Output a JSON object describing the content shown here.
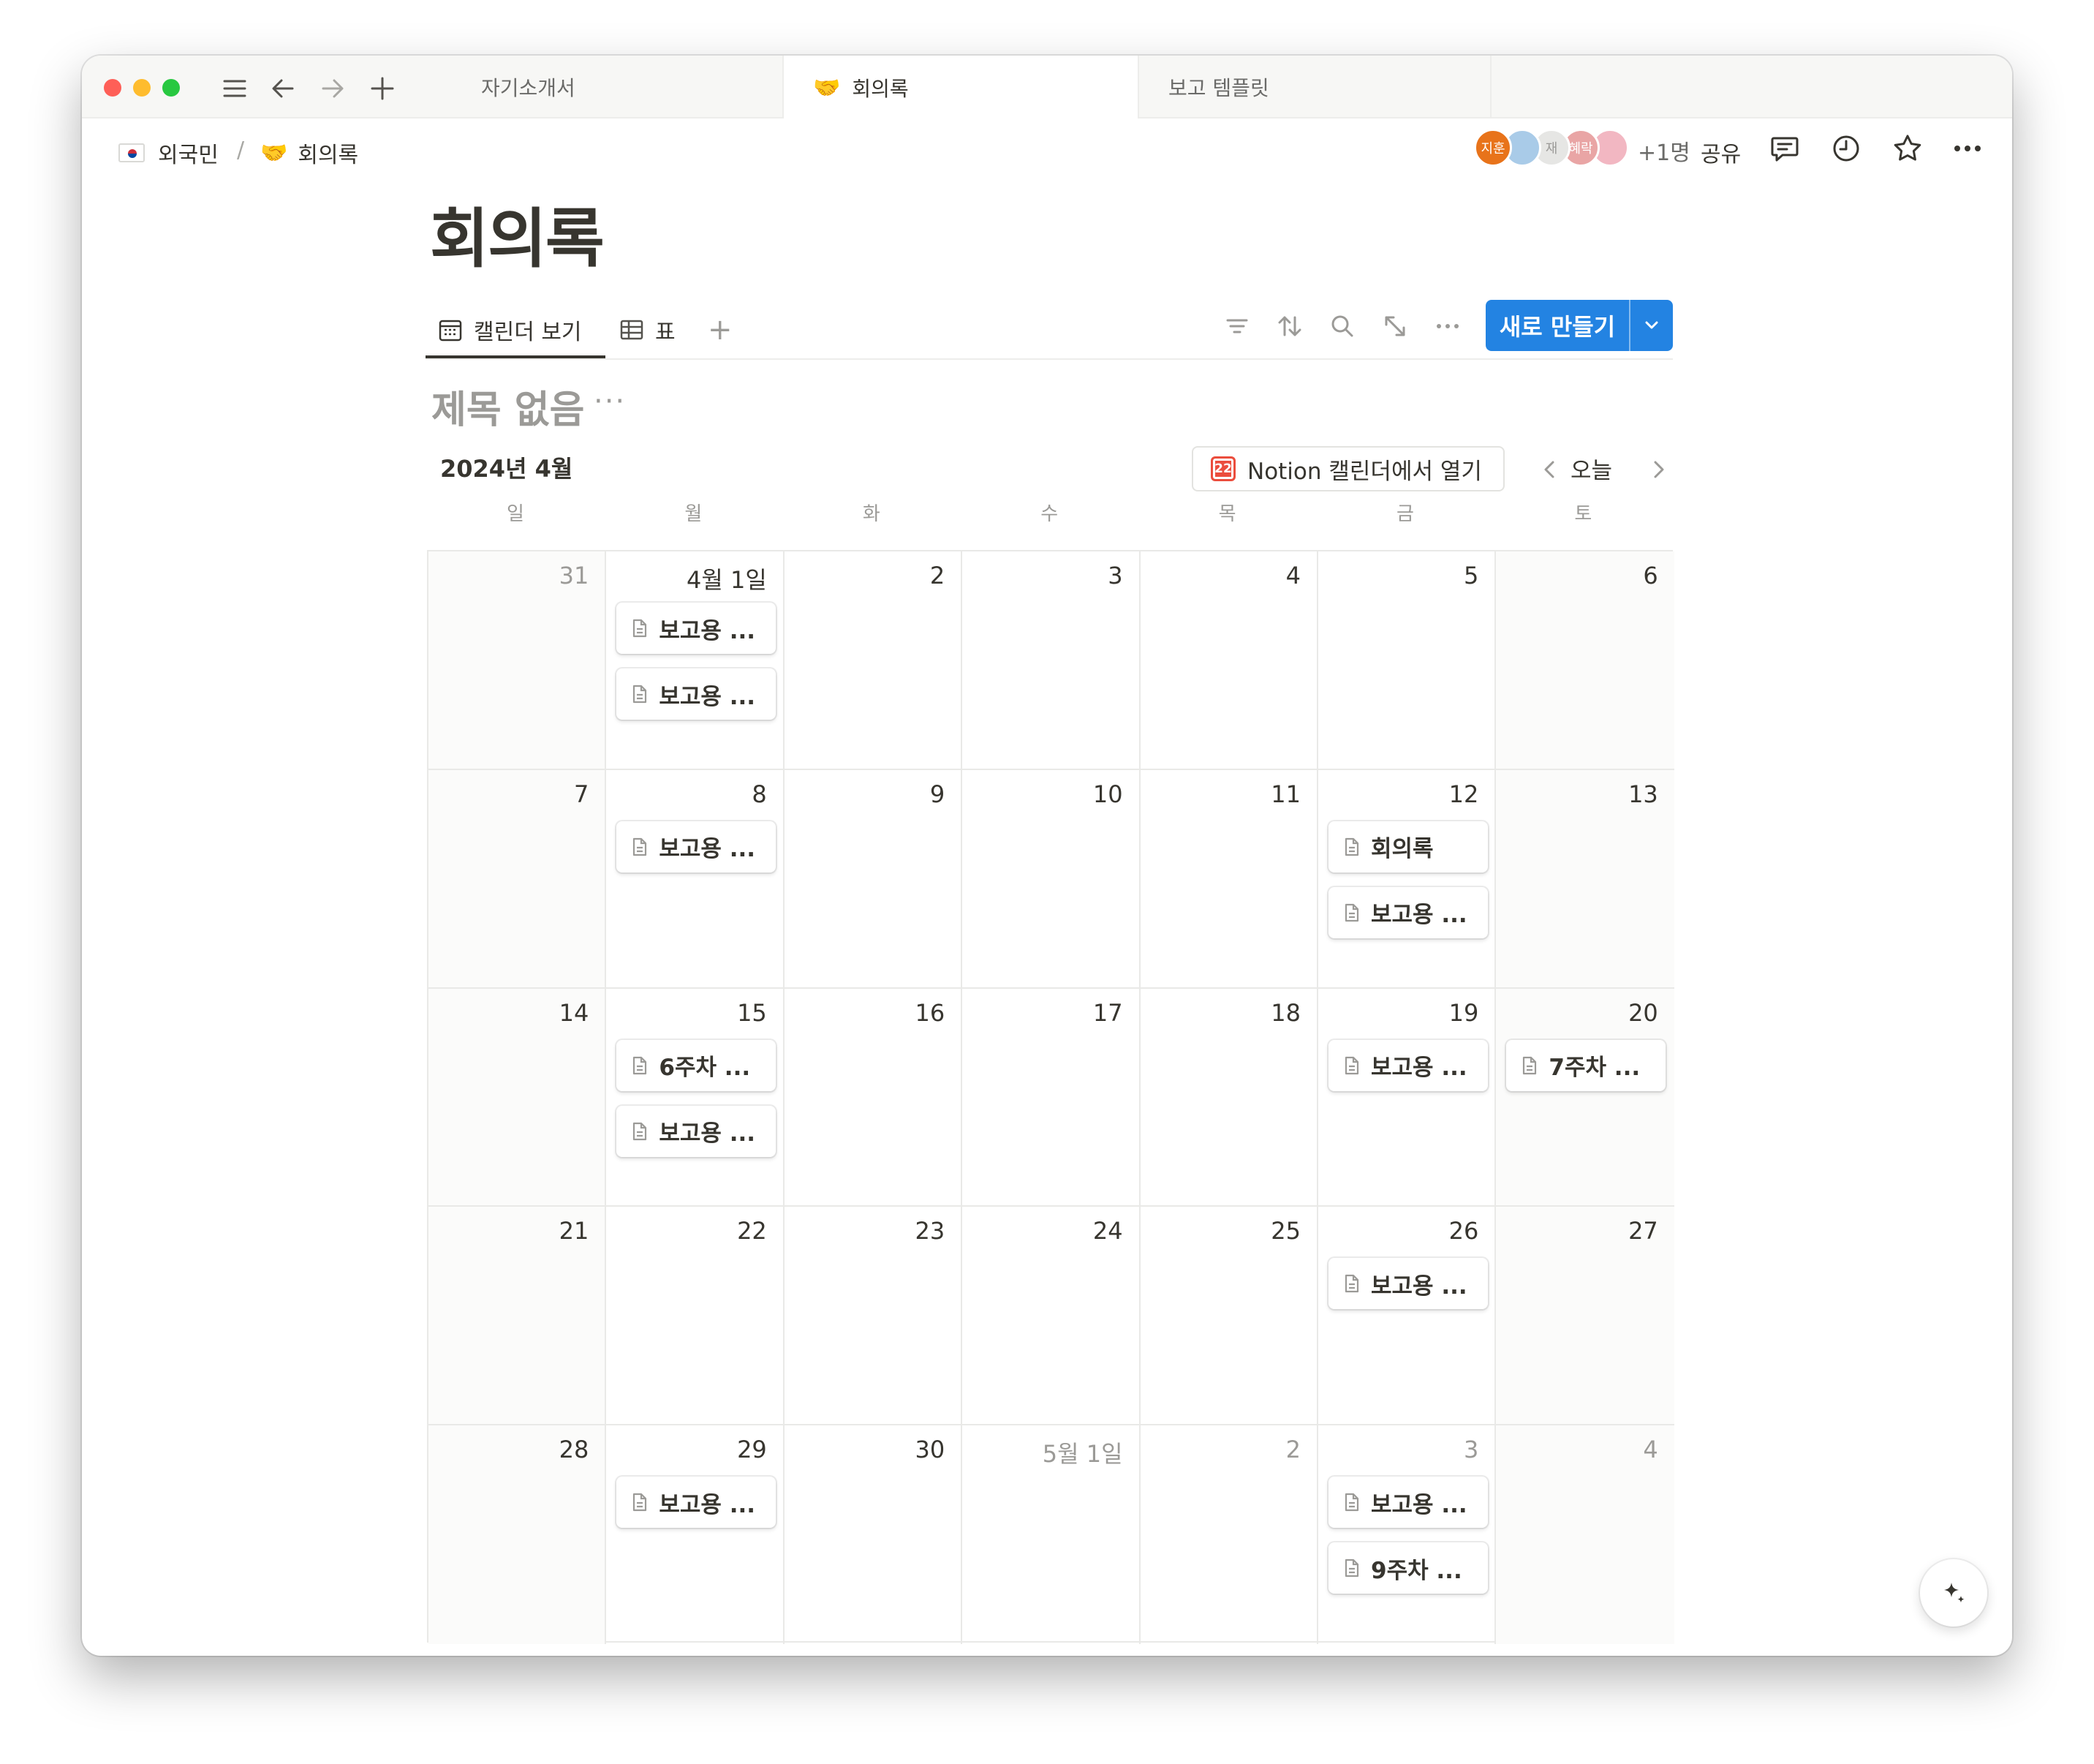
{
  "window": {
    "tabs": [
      {
        "label": "자기소개서",
        "emoji": ""
      },
      {
        "label": "회의록",
        "emoji": "🤝"
      },
      {
        "label": "보고 템플릿",
        "emoji": ""
      }
    ],
    "active_tab": 1
  },
  "breadcrumb": [
    {
      "label": "외국민",
      "icon": "korea-flag-icon"
    },
    {
      "label": "회의록",
      "icon": "handshake-icon",
      "emoji": "🤝"
    }
  ],
  "breadcrumb_separator": "/",
  "collaborators": {
    "avatars": [
      {
        "label": "지훈",
        "color": "#e8731a"
      },
      {
        "label": "",
        "color": "#a9cbe8"
      },
      {
        "label": "재",
        "color": "#e6e6e4"
      },
      {
        "label": "혜락",
        "color": "#e9a5a5"
      },
      {
        "label": "",
        "color": "#f2b7c2"
      }
    ],
    "more_count": "+1명"
  },
  "topbar": {
    "share_label": "공유"
  },
  "page": {
    "title": "회의록"
  },
  "views": {
    "calendar_label": "캘린더 보기",
    "table_label": "표",
    "add_label": "+"
  },
  "toolbar": {
    "new_label": "새로 만들기"
  },
  "database": {
    "title": "제목 없음",
    "more": "···"
  },
  "calendar": {
    "month_label": "2024년 4월",
    "open_in_calendar": "Notion 캘린더에서 열기",
    "calendar_icon_day": "22",
    "today_label": "오늘",
    "weekdays": [
      "일",
      "월",
      "화",
      "수",
      "목",
      "금",
      "토"
    ],
    "weeks": [
      [
        {
          "label": "31",
          "muted": true,
          "events": []
        },
        {
          "label": "4월 1일",
          "muted": false,
          "events": [
            "보고용 ...",
            " 보고용 ..."
          ]
        },
        {
          "label": "2",
          "muted": false,
          "events": []
        },
        {
          "label": "3",
          "muted": false,
          "events": []
        },
        {
          "label": "4",
          "muted": false,
          "events": []
        },
        {
          "label": "5",
          "muted": false,
          "events": []
        },
        {
          "label": "6",
          "muted": false,
          "events": []
        }
      ],
      [
        {
          "label": "7",
          "muted": false,
          "events": []
        },
        {
          "label": "8",
          "muted": false,
          "events": [
            "보고용 ..."
          ]
        },
        {
          "label": "9",
          "muted": false,
          "events": []
        },
        {
          "label": "10",
          "muted": false,
          "events": []
        },
        {
          "label": "11",
          "muted": false,
          "events": []
        },
        {
          "label": "12",
          "muted": false,
          "events": [
            "회의록",
            "보고용 ..."
          ]
        },
        {
          "label": "13",
          "muted": false,
          "events": []
        }
      ],
      [
        {
          "label": "14",
          "muted": false,
          "events": []
        },
        {
          "label": "15",
          "muted": false,
          "events": [
            "6주차 ...",
            "보고용 ..."
          ]
        },
        {
          "label": "16",
          "muted": false,
          "events": []
        },
        {
          "label": "17",
          "muted": false,
          "events": []
        },
        {
          "label": "18",
          "muted": false,
          "events": []
        },
        {
          "label": "19",
          "muted": false,
          "events": [
            "보고용 ..."
          ]
        },
        {
          "label": "20",
          "muted": false,
          "events": [
            "7주차 ..."
          ]
        }
      ],
      [
        {
          "label": "21",
          "muted": false,
          "events": []
        },
        {
          "label": "22",
          "muted": false,
          "events": []
        },
        {
          "label": "23",
          "muted": false,
          "events": []
        },
        {
          "label": "24",
          "muted": false,
          "events": []
        },
        {
          "label": "25",
          "muted": false,
          "events": []
        },
        {
          "label": "26",
          "muted": false,
          "events": [
            "보고용 ..."
          ]
        },
        {
          "label": "27",
          "muted": false,
          "events": []
        }
      ],
      [
        {
          "label": "28",
          "muted": false,
          "events": []
        },
        {
          "label": "29",
          "muted": false,
          "events": [
            "보고용 ..."
          ]
        },
        {
          "label": "30",
          "muted": false,
          "events": []
        },
        {
          "label": "5월 1일",
          "muted": true,
          "events": []
        },
        {
          "label": "2",
          "muted": true,
          "events": []
        },
        {
          "label": "3",
          "muted": true,
          "events": [
            "보고용 ...",
            "9주차 ..."
          ]
        },
        {
          "label": "4",
          "muted": true,
          "events": []
        }
      ]
    ]
  },
  "colors": {
    "accent": "#2383e2",
    "text": "#37352f",
    "muted": "#9b9a97"
  }
}
